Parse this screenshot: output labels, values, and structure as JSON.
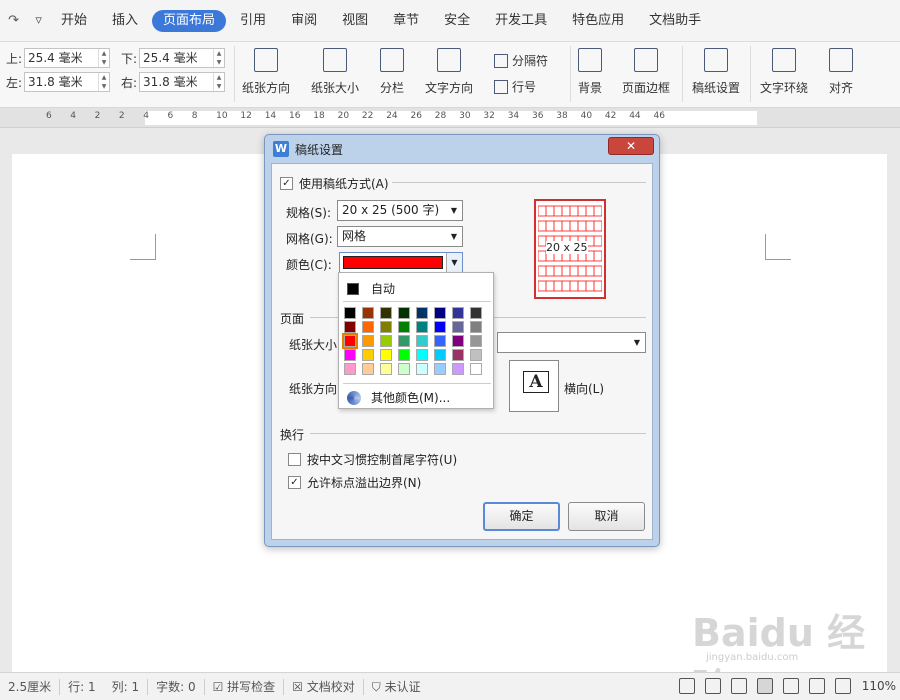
{
  "menu": {
    "quick_access": [
      "↷",
      "▿"
    ],
    "items": [
      {
        "label": "开始",
        "active": false
      },
      {
        "label": "插入",
        "active": false
      },
      {
        "label": "页面布局",
        "active": true
      },
      {
        "label": "引用",
        "active": false
      },
      {
        "label": "审阅",
        "active": false
      },
      {
        "label": "视图",
        "active": false
      },
      {
        "label": "章节",
        "active": false
      },
      {
        "label": "安全",
        "active": false
      },
      {
        "label": "开发工具",
        "active": false
      },
      {
        "label": "特色应用",
        "active": false
      },
      {
        "label": "文档助手",
        "active": false
      }
    ]
  },
  "toolbar": {
    "margins": {
      "top_label": "上:",
      "top_value": "25.4 毫米",
      "bottom_label": "下:",
      "bottom_value": "25.4 毫米",
      "left_label": "左:",
      "left_value": "31.8 毫米",
      "right_label": "右:",
      "right_value": "31.8 毫米"
    },
    "buttons": {
      "orientation": "纸张方向",
      "size": "纸张大小",
      "columns": "分栏",
      "text_direction": "文字方向",
      "separator": "分隔符",
      "line_number": "行号",
      "background": "背景",
      "page_border": "页面边框",
      "manuscript": "稿纸设置",
      "text_wrap": "文字环绕",
      "align": "对齐"
    }
  },
  "ruler": {
    "ticks": [
      "6",
      "4",
      "2",
      "2",
      "4",
      "6",
      "8",
      "10",
      "12",
      "14",
      "16",
      "18",
      "20",
      "22",
      "24",
      "26",
      "28",
      "30",
      "32",
      "34",
      "36",
      "38",
      "40",
      "42",
      "44",
      "46"
    ]
  },
  "dialog": {
    "title": "稿纸设置",
    "close": "✕",
    "use_manuscript_label": "使用稿纸方式(A)",
    "use_manuscript_checked": true,
    "spec_label": "规格(S):",
    "spec_value": "20 x 25 (500 字)",
    "grid_label": "网格(G):",
    "grid_value": "网格",
    "color_label": "颜色(C):",
    "color_value": "#ff0000",
    "preview_label": "20 x 25",
    "page_group": "页面",
    "paper_size_label": "纸张大小",
    "paper_orient_label": "纸张方向",
    "landscape_label": "横向(L)",
    "orientation_letter": "A",
    "wrap_group": "换行",
    "opt_chinese_rule": "按中文习惯控制首尾字符(U)",
    "opt_chinese_rule_checked": false,
    "opt_overflow": "允许标点溢出边界(N)",
    "opt_overflow_checked": true,
    "ok": "确定",
    "cancel": "取消"
  },
  "color_popup": {
    "auto_label": "自动",
    "more_label": "其他颜色(M)...",
    "selected": "#ff0000",
    "palette": [
      [
        "#000000",
        "#993300",
        "#333300",
        "#003300",
        "#003366",
        "#000080",
        "#333399",
        "#333333"
      ],
      [
        "#800000",
        "#ff6600",
        "#808000",
        "#008000",
        "#008080",
        "#0000ff",
        "#666699",
        "#808080"
      ],
      [
        "#ff0000",
        "#ff9900",
        "#99cc00",
        "#339966",
        "#33cccc",
        "#3366ff",
        "#800080",
        "#969696"
      ],
      [
        "#ff00ff",
        "#ffcc00",
        "#ffff00",
        "#00ff00",
        "#00ffff",
        "#00ccff",
        "#993366",
        "#c0c0c0"
      ],
      [
        "#ff99cc",
        "#ffcc99",
        "#ffff99",
        "#ccffcc",
        "#ccffff",
        "#99ccff",
        "#cc99ff",
        "#ffffff"
      ]
    ]
  },
  "statusbar": {
    "position": "2.5厘米",
    "line": "行: 1",
    "column": "列: 1",
    "chars": "字数: 0",
    "spell": "拼写检查",
    "proof": "文档校对",
    "auth": "未认证",
    "zoom": "110%"
  },
  "watermark": {
    "text": "Baidu 经验",
    "url": "jingyan.baidu.com"
  }
}
